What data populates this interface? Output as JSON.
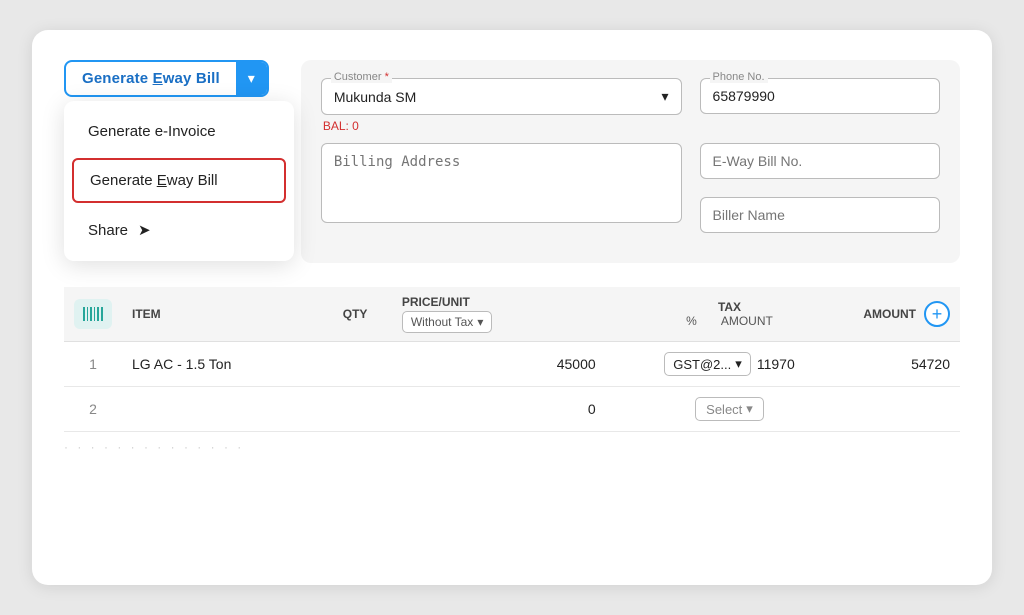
{
  "header": {
    "main_button_label": "Generate Eway Bill",
    "main_button_underline_char": "E",
    "chevron": "▾"
  },
  "dropdown": {
    "items": [
      {
        "id": "generate-einvoice",
        "label": "Generate e-Invoice",
        "active": false,
        "icon": null
      },
      {
        "id": "generate-eway",
        "label": "Generate Eway Bill",
        "active": true,
        "icon": null,
        "underline_char": "E"
      },
      {
        "id": "share",
        "label": "Share",
        "active": false,
        "icon": "➤"
      }
    ]
  },
  "form": {
    "customer_label": "Customer",
    "customer_required": "*",
    "customer_value": "Mukunda SM",
    "balance_label": "BAL: 0",
    "phone_label": "Phone No.",
    "phone_value": "65879990",
    "billing_address_placeholder": "Billing Address",
    "eway_bill_placeholder": "E-Way Bill No.",
    "biller_name_placeholder": "Biller Name"
  },
  "table": {
    "columns": {
      "barcode": "",
      "item": "ITEM",
      "qty": "QTY",
      "price_unit": "PRICE/UNIT",
      "price_sub": "Without Tax",
      "tax": "TAX",
      "tax_percent": "%",
      "tax_amount": "AMOUNT",
      "amount": "AMOUNT"
    },
    "rows": [
      {
        "num": "1",
        "item": "LG AC - 1.5 Ton",
        "qty": "",
        "price": "45000",
        "tax_label": "GST@2...",
        "tax_amount": "11970",
        "amount": "54720"
      },
      {
        "num": "2",
        "item": "",
        "qty": "",
        "price": "0",
        "tax_label": "Select",
        "tax_amount": "",
        "amount": ""
      }
    ],
    "dots": "· · · · · · · · · · · · · ·"
  },
  "colors": {
    "primary": "#2196f3",
    "accent_red": "#d32f2f",
    "teal": "#26a69a",
    "light_teal_bg": "#e0f2f1"
  }
}
